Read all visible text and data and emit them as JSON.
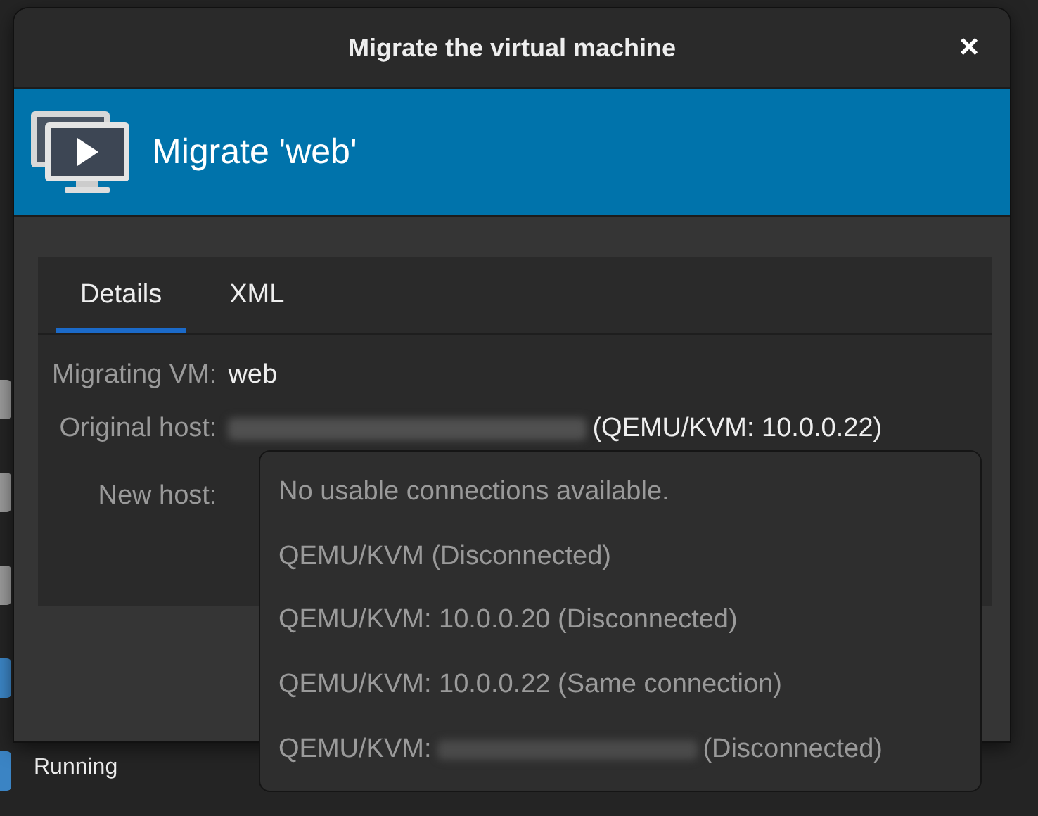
{
  "background_app": {
    "vm_status": "Running"
  },
  "window": {
    "title": "Migrate the virtual machine",
    "close": "×"
  },
  "header": {
    "title": "Migrate 'web'"
  },
  "tabs": [
    {
      "label": "Details",
      "selected": true
    },
    {
      "label": "XML",
      "selected": false
    }
  ],
  "details": {
    "migrating_vm": {
      "label": "Migrating VM:",
      "value": "web"
    },
    "original_host": {
      "label": "Original host:",
      "value": "(QEMU/KVM: 10.0.0.22)"
    },
    "new_host": {
      "label": "New host:"
    }
  },
  "new_host_menu": [
    {
      "kind": "plain",
      "text": "No usable connections available.",
      "disabled": true
    },
    {
      "kind": "plain",
      "text": "QEMU/KVM (Disconnected)",
      "disabled": true
    },
    {
      "kind": "plain",
      "text": "QEMU/KVM: 10.0.0.20 (Disconnected)",
      "disabled": true
    },
    {
      "kind": "plain",
      "text": "QEMU/KVM: 10.0.0.22 (Same connection)",
      "disabled": true
    },
    {
      "kind": "redacted",
      "text": "QEMU/KVM:",
      "after": "(Disconnected)",
      "disabled": true
    }
  ]
}
